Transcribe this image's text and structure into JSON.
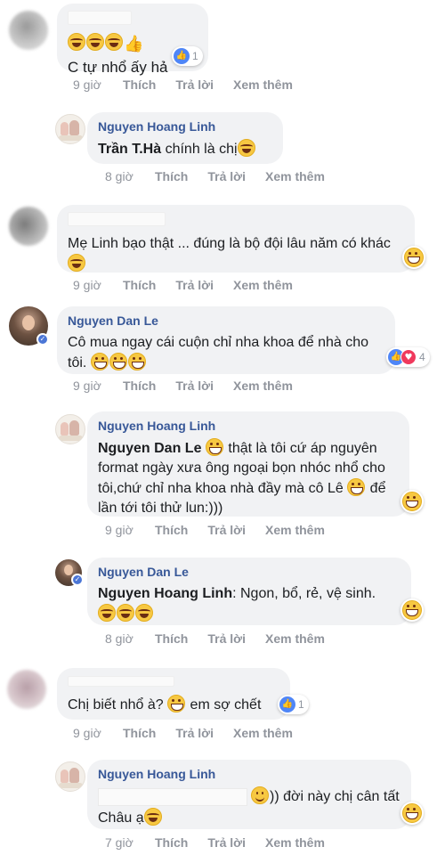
{
  "comments": [
    {
      "name": "",
      "text": "C tự nhổ ấy hả",
      "reaction_count": "1",
      "time": "9 giờ",
      "like": "Thích",
      "reply": "Trả lời",
      "more": "Xem thêm"
    },
    {
      "name": "Nguyen Hoang Linh",
      "mention": "Trần T.Hà",
      "text": " chính là chị",
      "time": "8 giờ",
      "like": "Thích",
      "reply": "Trả lời",
      "more": "Xem thêm"
    },
    {
      "name": "",
      "text": "Mẹ Linh bạo thật ... đúng là bộ đội lâu năm có khác",
      "time": "9 giờ",
      "like": "Thích",
      "reply": "Trả lời",
      "more": "Xem thêm"
    },
    {
      "name": "Nguyen Dan Le",
      "text": "Cô mua ngay cái cuộn chỉ nha khoa để nhà cho tôi.",
      "reaction_count": "4",
      "time": "9 giờ",
      "like": "Thích",
      "reply": "Trả lời",
      "more": "Xem thêm"
    },
    {
      "name": "Nguyen Hoang Linh",
      "mention": "Nguyen Dan Le",
      "text": " thật là tôi cứ áp nguyên format ngày xưa ông ngoại bọn nhóc nhổ cho tôi,chứ chỉ nha khoa nhà đầy mà cô Lê",
      "text2": " để lần tới tôi thử lun:)))",
      "time": "9 giờ",
      "like": "Thích",
      "reply": "Trả lời",
      "more": "Xem thêm"
    },
    {
      "name": "Nguyen Dan Le",
      "mention": "Nguyen Hoang Linh",
      "text": ": Ngon, bổ, rẻ, vệ sinh.",
      "time": "8 giờ",
      "like": "Thích",
      "reply": "Trả lời",
      "more": "Xem thêm"
    },
    {
      "name": "",
      "text": "Chị biết nhổ à?",
      "text2": " em sợ chết",
      "reaction_count": "1",
      "time": "9 giờ",
      "like": "Thích",
      "reply": "Trả lời",
      "more": "Xem thêm"
    },
    {
      "name": "Nguyen Hoang Linh",
      "text": ")) đời này chị cân tất Châu ạ",
      "time": "7 giờ",
      "like": "Thích",
      "reply": "Trả lời",
      "more": "Xem thêm"
    }
  ],
  "icons": {
    "like": "like-reaction-icon",
    "love": "love-reaction-icon",
    "haha": "haha-reaction-icon"
  },
  "colors": {
    "name": "#385898",
    "bubble": "#f1f2f4",
    "meta": "#90949c",
    "like": "#4f86f7",
    "love": "#f0395c"
  }
}
